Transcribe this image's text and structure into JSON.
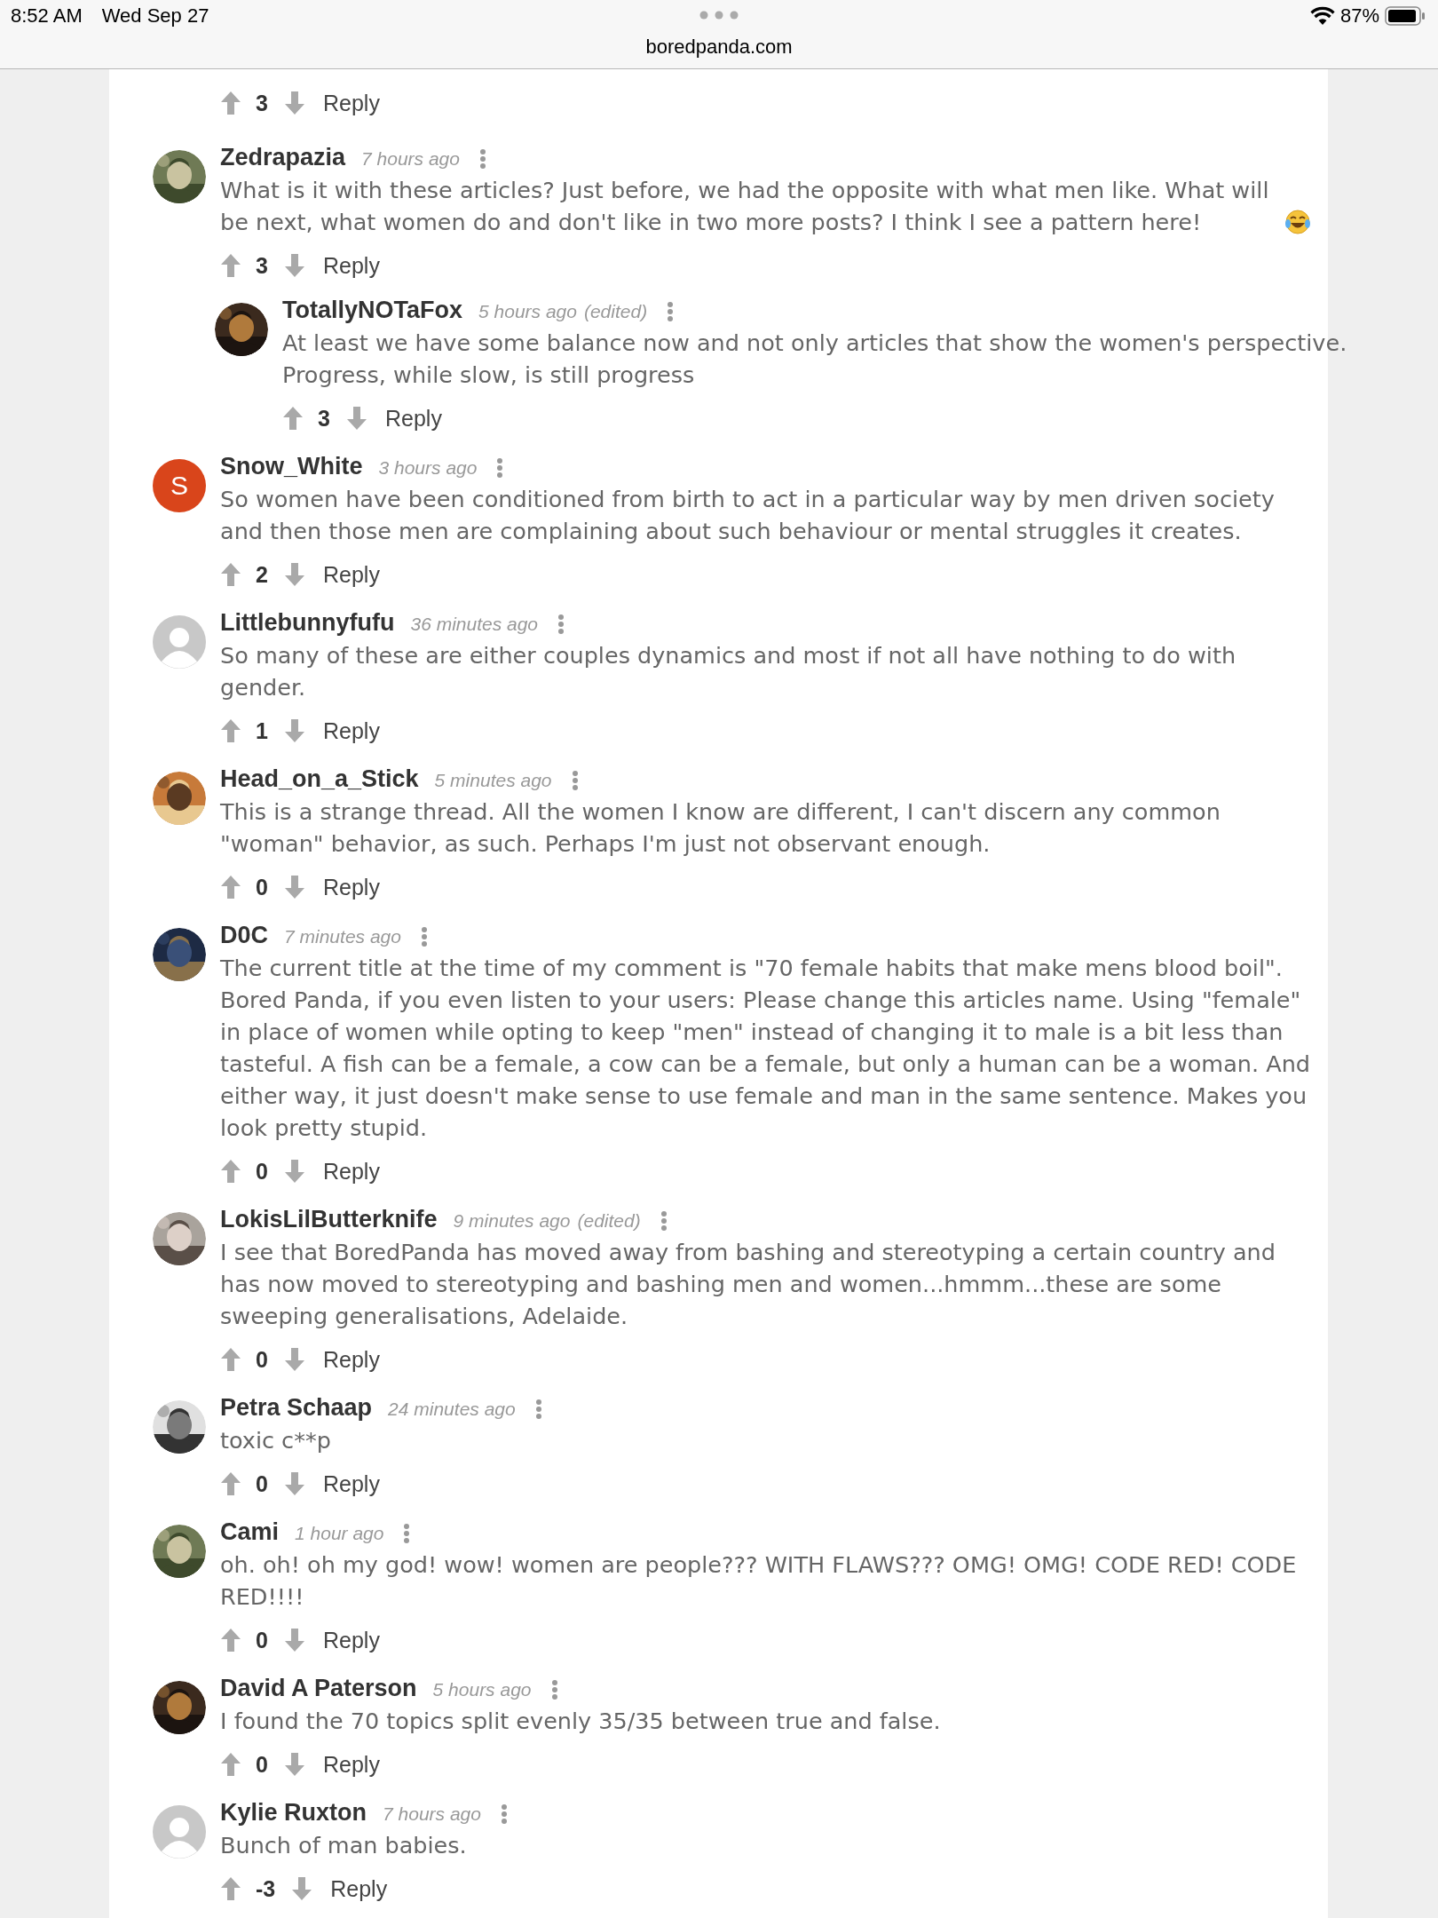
{
  "status_bar": {
    "time": "8:52 AM",
    "date": "Wed Sep 27",
    "url": "boredpanda.com",
    "battery": "87%"
  },
  "top_actions": {
    "votes": "3",
    "reply": "Reply"
  },
  "comments": [
    {
      "author": "Zedrapazia",
      "time": "7 hours ago",
      "text": "What is it with these articles? Just before, we had the opposite with what men like. What will be next, what women do and don't like in two more posts? I think I see a pattern here!",
      "trailing_emoji": true,
      "votes": "3",
      "reply": "Reply",
      "children": [
        {
          "author": "TotallyNOTaFox",
          "time": "5 hours ago",
          "edited": "(edited)",
          "text": "At least we have some balance now and not only articles that show the women's perspective. Progress, while slow, is still progress",
          "votes": "3",
          "reply": "Reply"
        }
      ]
    },
    {
      "author": "Snow_White",
      "time": "3 hours ago",
      "avatar": {
        "kind": "letter",
        "letter": "S"
      },
      "text": "So women have been conditioned from birth to act in a particular way by men driven society and then those men are complaining about such behaviour or mental struggles it creates.",
      "votes": "2",
      "reply": "Reply"
    },
    {
      "author": "Littlebunnyfufu",
      "time": "36 minutes ago",
      "avatar": {
        "kind": "default"
      },
      "text": "So many of these are either couples dynamics and most if not all have nothing to do with gender.",
      "votes": "1",
      "reply": "Reply"
    },
    {
      "author": "Head_on_a_Stick",
      "time": "5 minutes ago",
      "text": "This is a strange thread. All the women I know are different, I can't discern any common \"woman\" behavior, as such. Perhaps I'm just not observant enough.",
      "votes": "0",
      "reply": "Reply"
    },
    {
      "author": "D0C",
      "time": "7 minutes ago",
      "text": "The current title at the time of my comment is \"70 female habits that make mens blood boil\". Bored Panda, if you even listen to your users: Please change this articles name. Using \"female\" in place of women while opting to keep \"men\" instead of changing it to male is a bit less than tasteful. A fish can be a female, a cow can be a female, but only a human can be a woman. And either way, it just doesn't make sense to use female and man in the same sentence. Makes you look pretty stupid.",
      "votes": "0",
      "reply": "Reply"
    },
    {
      "author": "LokisLilButterknife",
      "time": "9 minutes ago",
      "edited": "(edited)",
      "text": "I see that BoredPanda has moved away from bashing and stereotyping a certain country and has now moved to stereotyping and bashing men and women...hmmm...these are some sweeping generalisations, Adelaide.",
      "votes": "0",
      "reply": "Reply"
    },
    {
      "author": "Petra Schaap",
      "time": "24 minutes ago",
      "text": "toxic c**p",
      "votes": "0",
      "reply": "Reply"
    },
    {
      "author": "Cami",
      "time": "1 hour ago",
      "text": "oh. oh! oh my god! wow! women are people??? WITH FLAWS??? OMG! OMG! CODE RED! CODE RED!!!!",
      "votes": "0",
      "reply": "Reply"
    },
    {
      "author": "David A Paterson",
      "time": "5 hours ago",
      "text": "I found the 70 topics split evenly 35/35 between true and false.",
      "votes": "0",
      "reply": "Reply"
    },
    {
      "author": "Kylie Ruxton",
      "time": "7 hours ago",
      "avatar": {
        "kind": "default"
      },
      "text": "Bunch of man babies.",
      "votes": "-3",
      "reply": "Reply"
    }
  ]
}
